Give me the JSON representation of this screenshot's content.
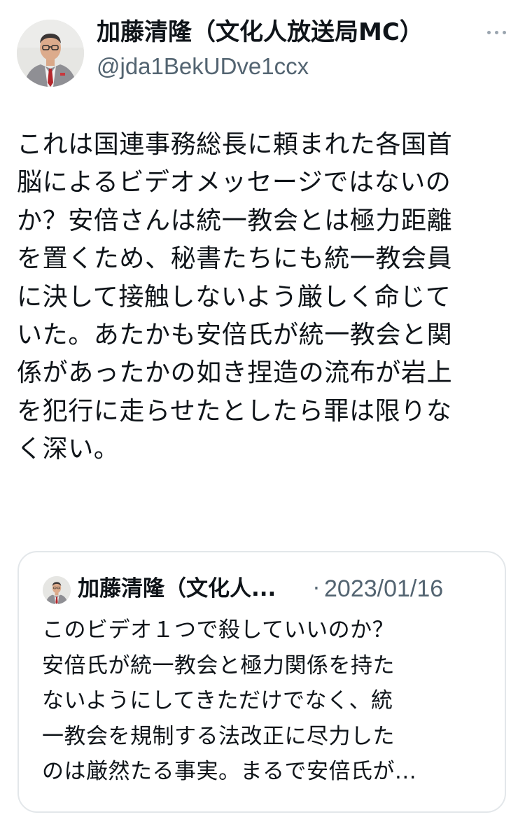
{
  "author": {
    "display_name": "加藤清隆（文化人放送局MC）",
    "handle": "@jda1BekUDve1ccx",
    "avatar_icon": "profile-photo"
  },
  "more_icon": "more-options-icon",
  "tweet": {
    "text": "これは国連事務総長に頼まれた各国首\n脳によるビデオメッセージではないの\nか？安倍さんは統一教会とは極力距離\nを置くため、秘書たちにも統一教会員\nに決して接触しないよう厳しく命じて\nいた。あたかも安倍氏が統一教会と関\n係があったかの如き捏造の流布が岩上\nを犯行に走らせたとしたら罪は限りな\nく深い。"
  },
  "quoted_tweet": {
    "display_name": "加藤清隆（文化人...",
    "separator": "·",
    "date": "2023/01/16",
    "text": "このビデオ１つで殺していいのか？\n安倍氏が統一教会と極力関係を持た\nないようにしてきただけでなく、統\n一教会を規制する法改正に尽力した\nのは厳然たる事実。まるで安倍氏が..."
  },
  "colors": {
    "text": "#0f1419",
    "secondary_text": "#536471",
    "border": "#e3e7ea",
    "background": "#ffffff"
  }
}
